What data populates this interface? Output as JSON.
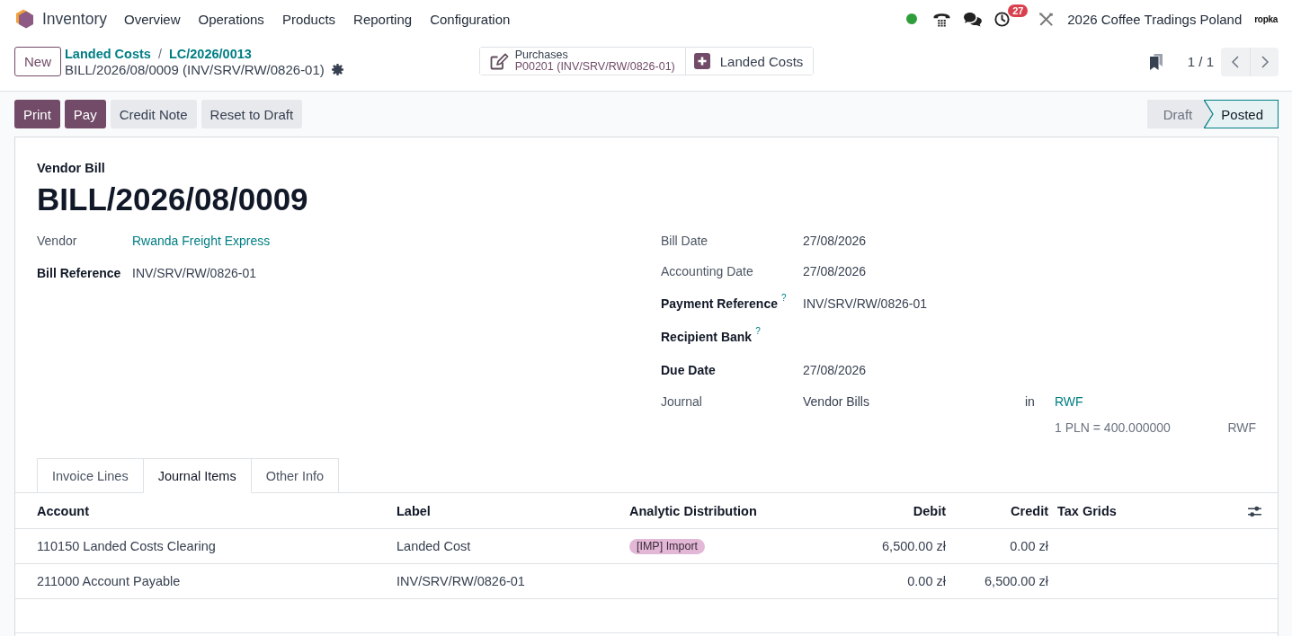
{
  "navbar": {
    "app_name": "Inventory",
    "menu": [
      {
        "label": "Overview"
      },
      {
        "label": "Operations"
      },
      {
        "label": "Products"
      },
      {
        "label": "Reporting"
      },
      {
        "label": "Configuration"
      }
    ],
    "activity_badge": "27",
    "company": "2026 Coffee Tradings Poland",
    "logo_text": "ropka"
  },
  "control_panel": {
    "new_button": "New",
    "breadcrumbs": [
      "Landed Costs",
      "LC/2026/0013"
    ],
    "breadcrumb_separator": "/",
    "record_title": "BILL/2026/08/0009 (INV/SRV/RW/0826-01)",
    "smart_buttons": [
      {
        "kind": "document",
        "label": "Purchases",
        "value": "P00201 (INV/SRV/RW/0826-01)"
      },
      {
        "kind": "add",
        "label": "Landed Costs"
      }
    ],
    "pager": "1 / 1"
  },
  "actions": [
    {
      "label": "Print",
      "kind": "primary"
    },
    {
      "label": "Pay",
      "kind": "primary"
    },
    {
      "label": "Credit Note",
      "kind": "secondary"
    },
    {
      "label": "Reset to Draft",
      "kind": "secondary"
    }
  ],
  "status_bar": [
    {
      "label": "Draft",
      "selected": false
    },
    {
      "label": "Posted",
      "selected": true
    }
  ],
  "form": {
    "type_label": "Vendor Bill",
    "name": "BILL/2026/08/0009",
    "left_fields": [
      {
        "label": "Vendor",
        "value": "Rwanda Freight Express",
        "kind": "link",
        "bold": false
      },
      {
        "label": "Bill Reference",
        "value": "INV/SRV/RW/0826-01",
        "kind": "text",
        "bold": true
      }
    ],
    "right_fields": [
      {
        "label": "Bill Date",
        "value": "27/08/2026",
        "kind": "text",
        "bold": false
      },
      {
        "label": "Accounting Date",
        "value": "27/08/2026",
        "kind": "text",
        "bold": false
      },
      {
        "label": "Payment Reference",
        "help": "?",
        "value": "INV/SRV/RW/0826-01",
        "kind": "text",
        "bold": true
      },
      {
        "label": "Recipient Bank",
        "help": "?",
        "bold": true
      },
      {
        "label": "Due Date",
        "value": "27/08/2026",
        "kind": "text",
        "bold": true
      }
    ],
    "journal": {
      "label": "Journal",
      "value": "Vendor Bills",
      "connector": "in",
      "currency": "RWF",
      "rate": "1 PLN = 400.000000",
      "rate_currency": "RWF"
    }
  },
  "tabs": [
    {
      "label": "Invoice Lines",
      "selected": false
    },
    {
      "label": "Journal Items",
      "selected": true
    },
    {
      "label": "Other Info",
      "selected": false
    }
  ],
  "table": {
    "columns": [
      {
        "label": "Account",
        "kind": "text"
      },
      {
        "label": "Label",
        "kind": "text"
      },
      {
        "label": "Analytic Distribution",
        "kind": "tags"
      },
      {
        "label": "Debit",
        "kind": "amount"
      },
      {
        "label": "Credit",
        "kind": "amount"
      },
      {
        "label": "Tax Grids",
        "kind": "text"
      }
    ],
    "rows": [
      {
        "account": "110150 Landed Costs Clearing",
        "label": "Landed Cost",
        "analytic_tags": [
          {
            "label": "[IMP] Import"
          }
        ],
        "debit": "6,500.00 zł",
        "credit": "0.00 zł"
      },
      {
        "account": "211000 Account Payable",
        "label": "INV/SRV/RW/0826-01",
        "debit": "0.00 zł",
        "credit": "6,500.00 zł"
      }
    ]
  }
}
